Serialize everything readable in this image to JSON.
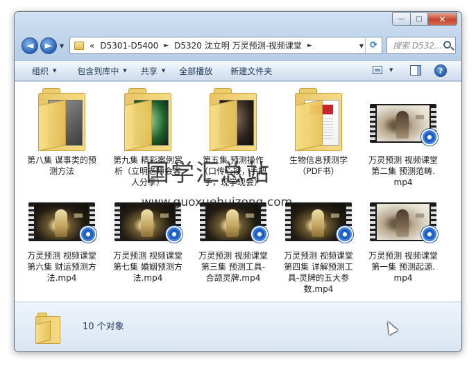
{
  "window": {
    "caption": {
      "minimize": "—",
      "maximize": "□",
      "close": "✕"
    }
  },
  "nav": {
    "back_icon": "◄",
    "forward_icon": "►",
    "address": {
      "lead": "«",
      "segments": [
        "D5301-D5400",
        "D5320 沈立明 万灵预测-视频课堂"
      ],
      "separator": "►"
    },
    "search_placeholder": "搜索 D532..."
  },
  "toolbar": {
    "organize": "组织",
    "include_in_library": "包含到库中",
    "share": "共享",
    "play_all": "全部播放",
    "new_folder": "新建文件夹",
    "help": "?"
  },
  "items": [
    {
      "type": "folder",
      "label": "第八集 谋事类的预测方法",
      "paper": "dark"
    },
    {
      "type": "folder",
      "label": "第九集 精彩案例赏析（立明老师会客人分享）",
      "paper": "green"
    },
    {
      "type": "folder",
      "label": "第五集 预测操作（口传心授，手把手，现学现会）",
      "paper": "shadow"
    },
    {
      "type": "folder",
      "label": "生物信息预测学（PDF书）",
      "paper": "doc"
    },
    {
      "type": "video",
      "label": "万灵预测 视频课堂 第二集 预测范畴.mp4",
      "frame": "light"
    },
    {
      "type": "video",
      "label": "万灵预测 视频课堂 第六集 财运预测方法.mp4",
      "frame": "dark"
    },
    {
      "type": "video",
      "label": "万灵预测 视频课堂 第七集 婚姻预测方法.mp4",
      "frame": "dark"
    },
    {
      "type": "video",
      "label": "万灵预测 视频课堂 第三集 预测工具-合颉灵牌.mp4",
      "frame": "dark"
    },
    {
      "type": "video",
      "label": "万灵预测 视频课堂 第四集 详解预测工具-灵牌的五大参数.mp4",
      "frame": "dark"
    },
    {
      "type": "video",
      "label": "万灵预测 视频课堂 第一集 预测起源.mp4",
      "frame": "light"
    }
  ],
  "details": {
    "count": "10 个对象"
  },
  "watermark": {
    "title": "国学汇总站",
    "url": "www.guoxuehuizong.com"
  }
}
